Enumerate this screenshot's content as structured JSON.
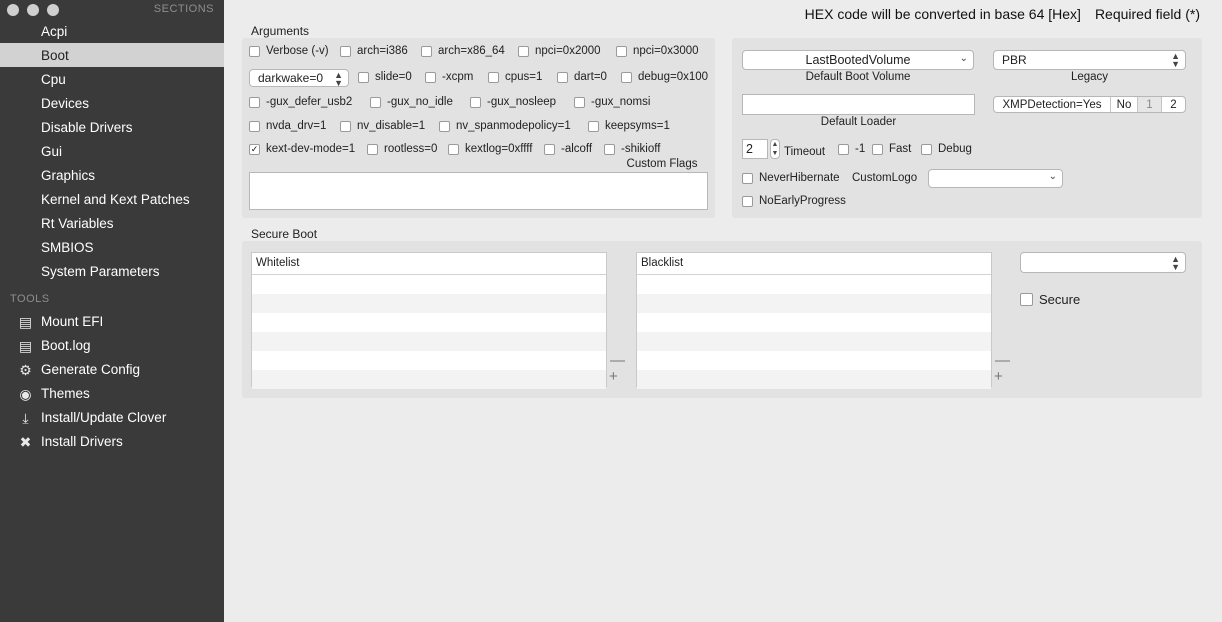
{
  "sidebar": {
    "sections_heading": "SECTIONS",
    "items": [
      {
        "label": "Acpi"
      },
      {
        "label": "Boot"
      },
      {
        "label": "Cpu"
      },
      {
        "label": "Devices"
      },
      {
        "label": "Disable Drivers"
      },
      {
        "label": "Gui"
      },
      {
        "label": "Graphics"
      },
      {
        "label": "Kernel and Kext Patches"
      },
      {
        "label": "Rt Variables"
      },
      {
        "label": "SMBIOS"
      },
      {
        "label": "System Parameters"
      }
    ],
    "tools_heading": "TOOLS",
    "tools": [
      {
        "label": "Mount EFI",
        "icon": "mount-efi-icon"
      },
      {
        "label": "Boot.log",
        "icon": "log-icon"
      },
      {
        "label": "Generate Config",
        "icon": "gear-icon"
      },
      {
        "label": "Themes",
        "icon": "palette-icon"
      },
      {
        "label": "Install/Update Clover",
        "icon": "download-icon"
      },
      {
        "label": "Install Drivers",
        "icon": "tools-icon"
      }
    ]
  },
  "header": {
    "hex_note": "HEX code will be converted in base 64 [Hex]",
    "required_note": "Required field (*)"
  },
  "arguments": {
    "title": "Arguments",
    "row1": [
      "Verbose (-v)",
      "arch=i386",
      "arch=x86_64",
      "npci=0x2000",
      "npci=0x3000"
    ],
    "darkwake_value": "darkwake=0",
    "row2": [
      "slide=0",
      "-xcpm",
      "cpus=1",
      "dart=0",
      "debug=0x100"
    ],
    "row3": [
      "-gux_defer_usb2",
      "-gux_no_idle",
      "-gux_nosleep",
      "-gux_nomsi"
    ],
    "row4": [
      "nvda_drv=1",
      "nv_disable=1",
      "nv_spanmodepolicy=1",
      "keepsyms=1"
    ],
    "row5": [
      "kext-dev-mode=1",
      "rootless=0",
      "kextlog=0xffff",
      "-alcoff",
      "-shikioff"
    ],
    "kext_dev_mode_checked": true,
    "custom_flags_label": "Custom Flags",
    "custom_flags_value": ""
  },
  "boot_options": {
    "default_boot_volume_value": "LastBootedVolume",
    "default_boot_volume_label": "Default Boot Volume",
    "legacy_value": "PBR",
    "legacy_label": "Legacy",
    "default_loader_value": "",
    "default_loader_label": "Default Loader",
    "xmp_label": "XMPDetection=Yes",
    "xmp_options": [
      "No",
      "1",
      "2"
    ],
    "timeout_value": "2",
    "timeout_label": "Timeout",
    "timeout_checks": [
      "-1",
      "Fast",
      "Debug"
    ],
    "never_hibernate_label": "NeverHibernate",
    "custom_logo_label": "CustomLogo",
    "custom_logo_value": "",
    "no_early_progress_label": "NoEarlyProgress"
  },
  "secure_boot": {
    "title": "Secure Boot",
    "whitelist_header": "Whitelist",
    "blacklist_header": "Blacklist",
    "policy_value": "",
    "secure_label": "Secure"
  }
}
